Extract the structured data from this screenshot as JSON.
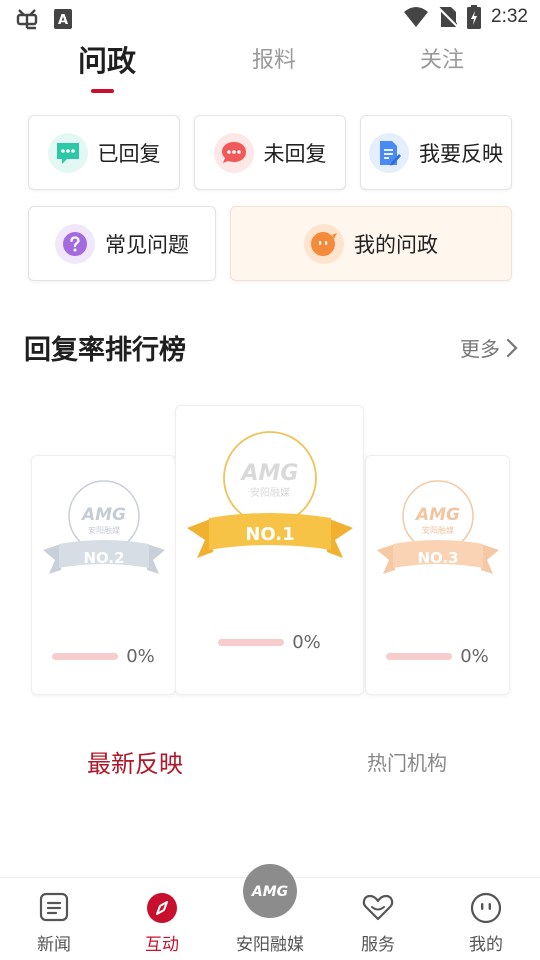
{
  "status_bar": {
    "time": "2:32",
    "left_icons": [
      "bug-icon",
      "font-a-icon"
    ],
    "right_icons": [
      "wifi-icon",
      "no-sim-icon",
      "battery-charging-icon"
    ]
  },
  "top_tabs": [
    {
      "label": "问政",
      "active": true
    },
    {
      "label": "报料",
      "active": false
    },
    {
      "label": "关注",
      "active": false
    }
  ],
  "actions": {
    "replied": {
      "label": "已回复",
      "icon": "chat-dots-icon",
      "color": "#2ec7a7"
    },
    "unreplied": {
      "label": "未回复",
      "icon": "chat-dots-icon",
      "color": "#f25a5a"
    },
    "report": {
      "label": "我要反映",
      "icon": "document-edit-icon",
      "color": "#4a8af4"
    },
    "faq": {
      "label": "常见问题",
      "icon": "question-icon",
      "color": "#a46ae0"
    },
    "my_wenzheng": {
      "label": "我的问政",
      "icon": "speech-face-icon",
      "color": "#f58a3a"
    }
  },
  "ranking": {
    "title": "回复率排行榜",
    "more_label": "更多",
    "logo_text": "AMG",
    "logo_sub": "安阳融媒",
    "entries": [
      {
        "rank_label": "NO.1",
        "rate_text": "0%",
        "rate": 0,
        "color": "#f4b63a"
      },
      {
        "rank_label": "NO.2",
        "rate_text": "0%",
        "rate": 0,
        "color": "#b8c2cf"
      },
      {
        "rank_label": "NO.3",
        "rate_text": "0%",
        "rate": 0,
        "color": "#f6c39a"
      }
    ]
  },
  "content_tabs": [
    {
      "label": "最新反映",
      "active": true
    },
    {
      "label": "热门机构",
      "active": false
    }
  ],
  "bottom_nav": [
    {
      "label": "新闻",
      "icon": "news-icon",
      "active": false
    },
    {
      "label": "互动",
      "icon": "compass-icon",
      "active": true
    },
    {
      "label": "安阳融媒",
      "icon": "amg-logo-icon",
      "active": false
    },
    {
      "label": "服务",
      "icon": "heart-icon",
      "active": false
    },
    {
      "label": "我的",
      "icon": "face-icon",
      "active": false
    }
  ],
  "colors": {
    "accent": "#c8102e",
    "tab_inactive": "#9a9a9a"
  }
}
